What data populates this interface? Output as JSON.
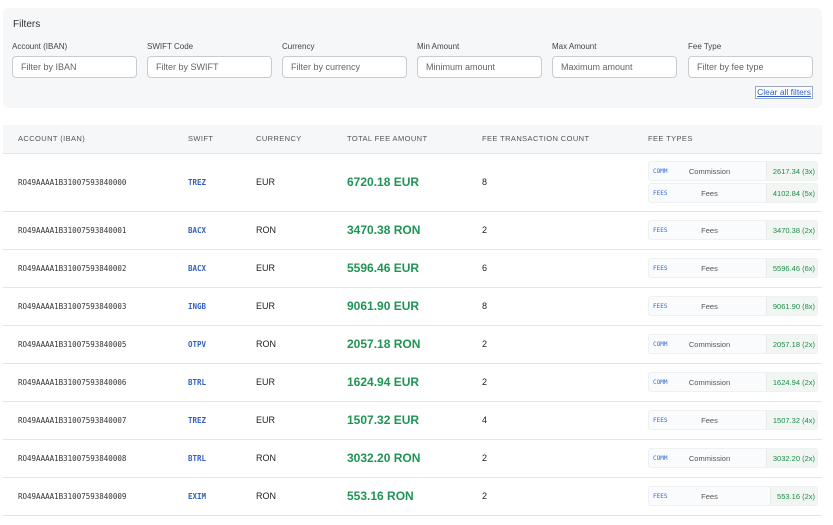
{
  "filters": {
    "title": "Filters",
    "fields": [
      {
        "label": "Account (IBAN)",
        "placeholder": "Filter by IBAN",
        "value": ""
      },
      {
        "label": "SWIFT Code",
        "placeholder": "Filter by SWIFT",
        "value": ""
      },
      {
        "label": "Currency",
        "placeholder": "Filter by currency",
        "value": ""
      },
      {
        "label": "Min Amount",
        "placeholder": "Minimum amount",
        "value": ""
      },
      {
        "label": "Max Amount",
        "placeholder": "Maximum amount",
        "value": ""
      },
      {
        "label": "Fee Type",
        "placeholder": "Filter by fee type",
        "value": ""
      }
    ],
    "clear_label": "Clear all filters"
  },
  "table": {
    "headers": [
      "ACCOUNT (IBAN)",
      "SWIFT",
      "CURRENCY",
      "TOTAL FEE AMOUNT",
      "FEE TRANSACTION COUNT",
      "FEE TYPES"
    ],
    "rows": [
      {
        "account": "RO49AAAA1B31007593840000",
        "swift": "TREZ",
        "currency": "EUR",
        "total": "6720.18 EUR",
        "count": "8",
        "fees": [
          {
            "code": "COMM",
            "name": "Commission",
            "amount": "2617.34 (3x)"
          },
          {
            "code": "FEES",
            "name": "Fees",
            "amount": "4102.84 (5x)"
          }
        ]
      },
      {
        "account": "RO49AAAA1B31007593840001",
        "swift": "BACX",
        "currency": "RON",
        "total": "3470.38 RON",
        "count": "2",
        "fees": [
          {
            "code": "FEES",
            "name": "Fees",
            "amount": "3470.38 (2x)"
          }
        ]
      },
      {
        "account": "RO49AAAA1B31007593840002",
        "swift": "BACX",
        "currency": "EUR",
        "total": "5596.46 EUR",
        "count": "6",
        "fees": [
          {
            "code": "FEES",
            "name": "Fees",
            "amount": "5596.46 (6x)"
          }
        ]
      },
      {
        "account": "RO49AAAA1B31007593840003",
        "swift": "INGB",
        "currency": "EUR",
        "total": "9061.90 EUR",
        "count": "8",
        "fees": [
          {
            "code": "FEES",
            "name": "Fees",
            "amount": "9061.90 (8x)"
          }
        ]
      },
      {
        "account": "RO49AAAA1B31007593840005",
        "swift": "OTPV",
        "currency": "RON",
        "total": "2057.18 RON",
        "count": "2",
        "fees": [
          {
            "code": "COMM",
            "name": "Commission",
            "amount": "2057.18 (2x)"
          }
        ]
      },
      {
        "account": "RO49AAAA1B31007593840006",
        "swift": "BTRL",
        "currency": "EUR",
        "total": "1624.94 EUR",
        "count": "2",
        "fees": [
          {
            "code": "COMM",
            "name": "Commission",
            "amount": "1624.94 (2x)"
          }
        ]
      },
      {
        "account": "RO49AAAA1B31007593840007",
        "swift": "TREZ",
        "currency": "EUR",
        "total": "1507.32 EUR",
        "count": "4",
        "fees": [
          {
            "code": "FEES",
            "name": "Fees",
            "amount": "1507.32 (4x)"
          }
        ]
      },
      {
        "account": "RO49AAAA1B31007593840008",
        "swift": "BTRL",
        "currency": "RON",
        "total": "3032.20 RON",
        "count": "2",
        "fees": [
          {
            "code": "COMM",
            "name": "Commission",
            "amount": "3032.20 (2x)"
          }
        ]
      },
      {
        "account": "RO49AAAA1B31007593840009",
        "swift": "EXIM",
        "currency": "RON",
        "total": "553.16 RON",
        "count": "2",
        "fees": [
          {
            "code": "FEES",
            "name": "Fees",
            "amount": "553.16 (2x)"
          }
        ]
      }
    ]
  },
  "colors": {
    "accent": "#2f5fc4",
    "amount": "#1f9455",
    "panel": "#f6f7f8"
  }
}
